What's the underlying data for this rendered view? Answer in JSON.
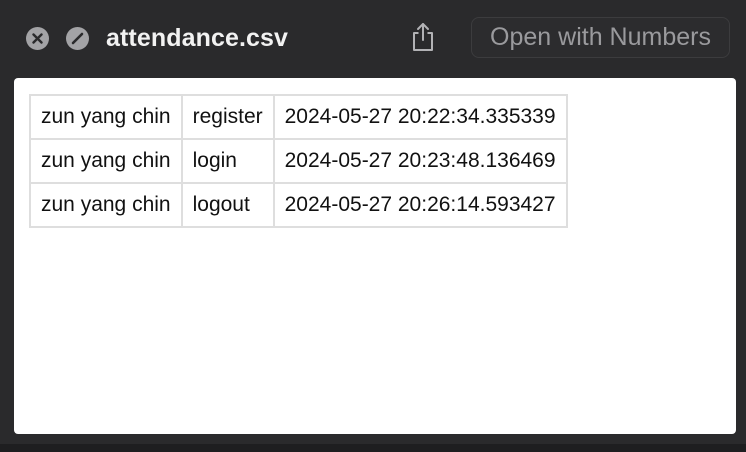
{
  "window": {
    "title": "attendance.csv",
    "open_button_label": "Open with Numbers",
    "icons": {
      "close": "close-icon",
      "fullscreen": "fullscreen-icon",
      "share": "share-icon"
    }
  },
  "table": {
    "rows": [
      [
        "zun yang chin",
        "register",
        "2024-05-27 20:22:34.335339"
      ],
      [
        "zun yang chin",
        "login",
        "2024-05-27 20:23:48.136469"
      ],
      [
        "zun yang chin",
        "logout",
        "2024-05-27 20:26:14.593427"
      ]
    ]
  }
}
